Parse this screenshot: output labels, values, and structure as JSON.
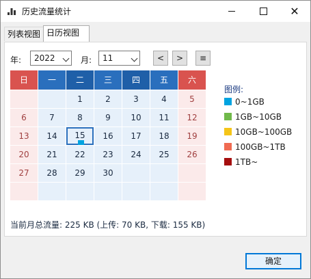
{
  "window": {
    "title": "历史流量统计",
    "controls": {
      "minimize": "minimize-icon",
      "maximize": "maximize-icon",
      "close": "✕"
    }
  },
  "tabs": [
    {
      "label": "列表视图",
      "selected": false
    },
    {
      "label": "日历视图",
      "selected": true
    }
  ],
  "controls": {
    "year_label": "年:",
    "year_value": "2022",
    "month_label": "月:",
    "month_value": "11",
    "prev_label": "<",
    "next_label": ">",
    "menu_label": "≡"
  },
  "calendar": {
    "weekday_headers": [
      "日",
      "一",
      "二",
      "三",
      "四",
      "五",
      "六"
    ],
    "weeks": [
      [
        "",
        "",
        "1",
        "2",
        "3",
        "4",
        "5"
      ],
      [
        "6",
        "7",
        "8",
        "9",
        "10",
        "11",
        "12"
      ],
      [
        "13",
        "14",
        "15",
        "16",
        "17",
        "18",
        "19"
      ],
      [
        "20",
        "21",
        "22",
        "23",
        "24",
        "25",
        "26"
      ],
      [
        "27",
        "28",
        "29",
        "30",
        "",
        "",
        ""
      ],
      [
        "",
        "",
        "",
        "",
        "",
        "",
        ""
      ]
    ],
    "today": "15",
    "today_usage_color": "#00a3e0"
  },
  "legend": {
    "title": "图例:",
    "items": [
      {
        "label": "0~1GB",
        "color": "#00a3e0"
      },
      {
        "label": "1GB~10GB",
        "color": "#70b94a"
      },
      {
        "label": "10GB~100GB",
        "color": "#f5c518"
      },
      {
        "label": "100GB~1TB",
        "color": "#f06b52"
      },
      {
        "label": "1TB~",
        "color": "#a50f0f"
      }
    ]
  },
  "summary": "当前月总流量: 225 KB (上传: 70 KB, 下载: 155 KB)",
  "ok_button": "确定"
}
